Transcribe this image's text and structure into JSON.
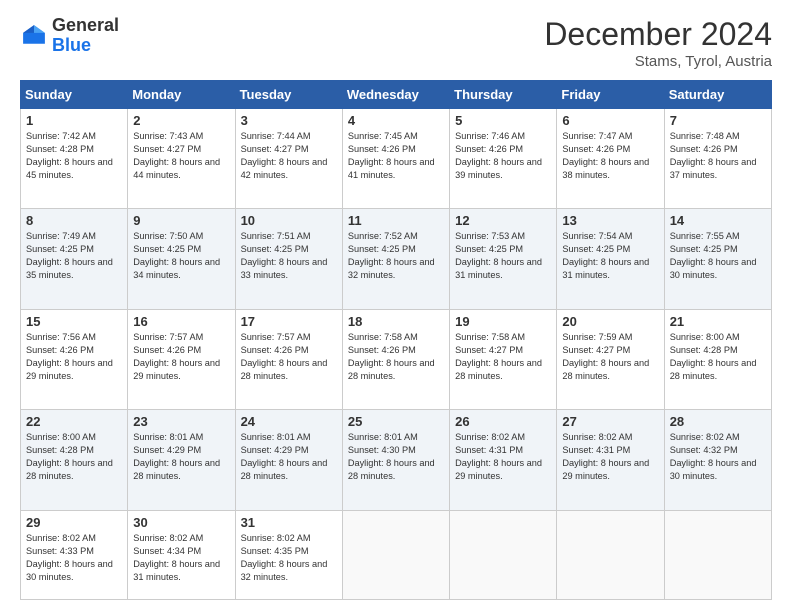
{
  "header": {
    "logo_general": "General",
    "logo_blue": "Blue",
    "month_title": "December 2024",
    "subtitle": "Stams, Tyrol, Austria"
  },
  "days_of_week": [
    "Sunday",
    "Monday",
    "Tuesday",
    "Wednesday",
    "Thursday",
    "Friday",
    "Saturday"
  ],
  "weeks": [
    [
      {
        "day": "1",
        "sunrise": "7:42 AM",
        "sunset": "4:28 PM",
        "daylight": "8 hours and 45 minutes."
      },
      {
        "day": "2",
        "sunrise": "7:43 AM",
        "sunset": "4:27 PM",
        "daylight": "8 hours and 44 minutes."
      },
      {
        "day": "3",
        "sunrise": "7:44 AM",
        "sunset": "4:27 PM",
        "daylight": "8 hours and 42 minutes."
      },
      {
        "day": "4",
        "sunrise": "7:45 AM",
        "sunset": "4:26 PM",
        "daylight": "8 hours and 41 minutes."
      },
      {
        "day": "5",
        "sunrise": "7:46 AM",
        "sunset": "4:26 PM",
        "daylight": "8 hours and 39 minutes."
      },
      {
        "day": "6",
        "sunrise": "7:47 AM",
        "sunset": "4:26 PM",
        "daylight": "8 hours and 38 minutes."
      },
      {
        "day": "7",
        "sunrise": "7:48 AM",
        "sunset": "4:26 PM",
        "daylight": "8 hours and 37 minutes."
      }
    ],
    [
      {
        "day": "8",
        "sunrise": "7:49 AM",
        "sunset": "4:25 PM",
        "daylight": "8 hours and 35 minutes."
      },
      {
        "day": "9",
        "sunrise": "7:50 AM",
        "sunset": "4:25 PM",
        "daylight": "8 hours and 34 minutes."
      },
      {
        "day": "10",
        "sunrise": "7:51 AM",
        "sunset": "4:25 PM",
        "daylight": "8 hours and 33 minutes."
      },
      {
        "day": "11",
        "sunrise": "7:52 AM",
        "sunset": "4:25 PM",
        "daylight": "8 hours and 32 minutes."
      },
      {
        "day": "12",
        "sunrise": "7:53 AM",
        "sunset": "4:25 PM",
        "daylight": "8 hours and 31 minutes."
      },
      {
        "day": "13",
        "sunrise": "7:54 AM",
        "sunset": "4:25 PM",
        "daylight": "8 hours and 31 minutes."
      },
      {
        "day": "14",
        "sunrise": "7:55 AM",
        "sunset": "4:25 PM",
        "daylight": "8 hours and 30 minutes."
      }
    ],
    [
      {
        "day": "15",
        "sunrise": "7:56 AM",
        "sunset": "4:26 PM",
        "daylight": "8 hours and 29 minutes."
      },
      {
        "day": "16",
        "sunrise": "7:57 AM",
        "sunset": "4:26 PM",
        "daylight": "8 hours and 29 minutes."
      },
      {
        "day": "17",
        "sunrise": "7:57 AM",
        "sunset": "4:26 PM",
        "daylight": "8 hours and 28 minutes."
      },
      {
        "day": "18",
        "sunrise": "7:58 AM",
        "sunset": "4:26 PM",
        "daylight": "8 hours and 28 minutes."
      },
      {
        "day": "19",
        "sunrise": "7:58 AM",
        "sunset": "4:27 PM",
        "daylight": "8 hours and 28 minutes."
      },
      {
        "day": "20",
        "sunrise": "7:59 AM",
        "sunset": "4:27 PM",
        "daylight": "8 hours and 28 minutes."
      },
      {
        "day": "21",
        "sunrise": "8:00 AM",
        "sunset": "4:28 PM",
        "daylight": "8 hours and 28 minutes."
      }
    ],
    [
      {
        "day": "22",
        "sunrise": "8:00 AM",
        "sunset": "4:28 PM",
        "daylight": "8 hours and 28 minutes."
      },
      {
        "day": "23",
        "sunrise": "8:01 AM",
        "sunset": "4:29 PM",
        "daylight": "8 hours and 28 minutes."
      },
      {
        "day": "24",
        "sunrise": "8:01 AM",
        "sunset": "4:29 PM",
        "daylight": "8 hours and 28 minutes."
      },
      {
        "day": "25",
        "sunrise": "8:01 AM",
        "sunset": "4:30 PM",
        "daylight": "8 hours and 28 minutes."
      },
      {
        "day": "26",
        "sunrise": "8:02 AM",
        "sunset": "4:31 PM",
        "daylight": "8 hours and 29 minutes."
      },
      {
        "day": "27",
        "sunrise": "8:02 AM",
        "sunset": "4:31 PM",
        "daylight": "8 hours and 29 minutes."
      },
      {
        "day": "28",
        "sunrise": "8:02 AM",
        "sunset": "4:32 PM",
        "daylight": "8 hours and 30 minutes."
      }
    ],
    [
      {
        "day": "29",
        "sunrise": "8:02 AM",
        "sunset": "4:33 PM",
        "daylight": "8 hours and 30 minutes."
      },
      {
        "day": "30",
        "sunrise": "8:02 AM",
        "sunset": "4:34 PM",
        "daylight": "8 hours and 31 minutes."
      },
      {
        "day": "31",
        "sunrise": "8:02 AM",
        "sunset": "4:35 PM",
        "daylight": "8 hours and 32 minutes."
      },
      null,
      null,
      null,
      null
    ]
  ],
  "labels": {
    "sunrise": "Sunrise:",
    "sunset": "Sunset:",
    "daylight": "Daylight:"
  }
}
